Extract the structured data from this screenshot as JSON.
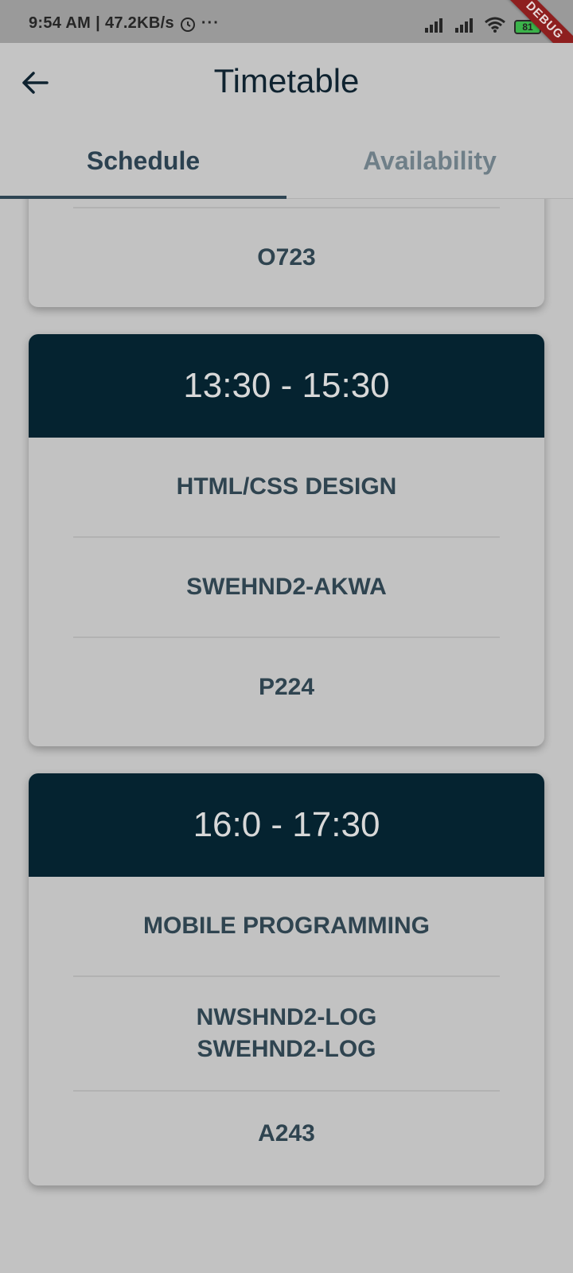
{
  "status_bar": {
    "time": "9:54 AM",
    "speed": "47.2KB/s",
    "battery": "81",
    "debug": "DEBUG",
    "more": "···"
  },
  "app_bar": {
    "title": "Timetable"
  },
  "tabs": [
    {
      "label": "Schedule",
      "active": true
    },
    {
      "label": "Availability",
      "active": false
    }
  ],
  "schedule": {
    "partial_card": {
      "room": "O723"
    },
    "cards": [
      {
        "time": "13:30 - 15:30",
        "course": "HTML/CSS DESIGN",
        "groups": [
          "SWEHND2-AKWA"
        ],
        "room": "P224"
      },
      {
        "time": "16:0 - 17:30",
        "course": "MOBILE PROGRAMMING",
        "groups": [
          "NWSHND2-LOG",
          "SWEHND2-LOG"
        ],
        "room": "A243"
      }
    ]
  },
  "colors": {
    "header_bg": "#052330",
    "background": "#c2c2c2",
    "text": "#2f4450"
  }
}
